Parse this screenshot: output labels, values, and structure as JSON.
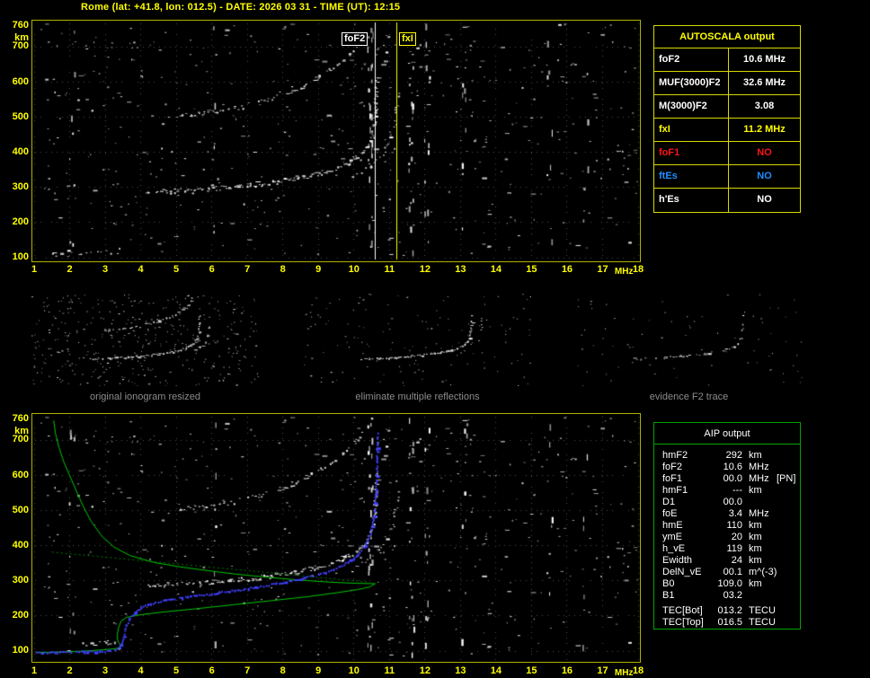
{
  "header": {
    "title": "Rome (lat: +41.8, lon: 012.5) - DATE: 2026 03 31 - TIME (UT): 12:15"
  },
  "colors": {
    "accent_yellow": "#ffff00",
    "frame_olive": "#b0b000",
    "profile_green": "#00c800",
    "trace_blue": "#4040ff",
    "no_red": "#ff1414",
    "ftes_blue": "#1e8fff",
    "caption_gray": "#8c8c8c",
    "table_green_border": "#00a400"
  },
  "autoscala_table": {
    "title": "AUTOSCALA output",
    "rows": [
      {
        "label": "foF2",
        "value": "10.6 MHz",
        "color": "white"
      },
      {
        "label": "MUF(3000)F2",
        "value": "32.6 MHz",
        "color": "white"
      },
      {
        "label": "M(3000)F2",
        "value": "3.08",
        "color": "white"
      },
      {
        "label": "fxI",
        "value": "11.2 MHz",
        "color": "yellow"
      },
      {
        "label": "foF1",
        "value": "NO",
        "color": "red"
      },
      {
        "label": "ftEs",
        "value": "NO",
        "color": "blue"
      },
      {
        "label": "h'Es",
        "value": "NO",
        "color": "white"
      }
    ]
  },
  "aip_table": {
    "title": "AIP output",
    "rows": [
      {
        "label": "hmF2",
        "value": "292",
        "unit": "km",
        "extra": ""
      },
      {
        "label": "foF2",
        "value": "10.6",
        "unit": "MHz",
        "extra": ""
      },
      {
        "label": "foF1",
        "value": "00.0",
        "unit": "MHz",
        "extra": "[PN]"
      },
      {
        "label": "hmF1",
        "value": "---",
        "unit": "km",
        "extra": ""
      },
      {
        "label": "D1",
        "value": "00.0",
        "unit": "",
        "extra": ""
      },
      {
        "label": "foE",
        "value": "3.4",
        "unit": "MHz",
        "extra": ""
      },
      {
        "label": "hmE",
        "value": "110",
        "unit": "km",
        "extra": ""
      },
      {
        "label": "ymE",
        "value": "20",
        "unit": "km",
        "extra": ""
      },
      {
        "label": "h_vE",
        "value": "119",
        "unit": "km",
        "extra": ""
      },
      {
        "label": "Ewidth",
        "value": "24",
        "unit": "km",
        "extra": ""
      },
      {
        "label": "DelN_vE",
        "value": "00.1",
        "unit": "m^(-3)",
        "extra": ""
      },
      {
        "label": "B0",
        "value": "109.0",
        "unit": "km",
        "extra": ""
      },
      {
        "label": "B1",
        "value": "03.2",
        "unit": "",
        "extra": ""
      },
      {
        "label": "TEC[Bot]",
        "value": "013.2",
        "unit": "TECU",
        "extra": ""
      },
      {
        "label": "TEC[Top]",
        "value": "016.5",
        "unit": "TECU",
        "extra": ""
      }
    ]
  },
  "thumbnails": [
    {
      "caption": "original ionogram resized"
    },
    {
      "caption": "eliminate multiple reflections"
    },
    {
      "caption": "evidence F2 trace"
    }
  ],
  "chart_data": [
    {
      "type": "scatter",
      "title": "recorded ionogram with autoscaled critical frequencies",
      "xlabel": "MHz",
      "ylabel": "km",
      "xlim": [
        1,
        18
      ],
      "ylim": [
        100,
        760
      ],
      "x_ticks": [
        1,
        2,
        3,
        4,
        5,
        6,
        7,
        8,
        9,
        10,
        11,
        12,
        13,
        14,
        15,
        16,
        17,
        18
      ],
      "y_ticks": [
        760,
        700,
        600,
        500,
        400,
        300,
        200,
        100
      ],
      "grid": "dotted",
      "annotations": [
        {
          "label": "foF2",
          "x_mhz": 10.6,
          "color": "#ffffff"
        },
        {
          "label": "fxI",
          "x_mhz": 11.2,
          "color": "#ffff00"
        }
      ],
      "series": [
        {
          "name": "F2-trace-1st-hop",
          "style": "speckle",
          "density": 0.85,
          "min_gray": 180,
          "points": [
            [
              4.15,
              288
            ],
            [
              4.7,
              290
            ],
            [
              5.3,
              293
            ],
            [
              5.9,
              297
            ],
            [
              6.5,
              302
            ],
            [
              7.1,
              308
            ],
            [
              7.7,
              316
            ],
            [
              8.3,
              326
            ],
            [
              8.9,
              338
            ],
            [
              9.4,
              352
            ],
            [
              9.8,
              368
            ],
            [
              10.1,
              388
            ],
            [
              10.35,
              415
            ],
            [
              10.5,
              450
            ],
            [
              10.57,
              495
            ],
            [
              10.61,
              555
            ],
            [
              10.63,
              615
            ]
          ]
        },
        {
          "name": "F2-trace-2nd-hop",
          "style": "speckle",
          "density": 0.55,
          "min_gray": 165,
          "points": [
            [
              5.0,
              505
            ],
            [
              5.6,
              510
            ],
            [
              6.2,
              518
            ],
            [
              6.8,
              530
            ],
            [
              7.4,
              545
            ],
            [
              8.0,
              565
            ],
            [
              8.5,
              588
            ],
            [
              9.0,
              614
            ],
            [
              9.4,
              642
            ],
            [
              9.75,
              672
            ],
            [
              10.05,
              700
            ],
            [
              10.25,
              728
            ]
          ]
        },
        {
          "name": "X-mode-trace",
          "style": "speckle",
          "density": 0.45,
          "min_gray": 160,
          "points": [
            [
              9.9,
              330
            ],
            [
              10.3,
              352
            ],
            [
              10.7,
              382
            ],
            [
              10.95,
              420
            ],
            [
              11.1,
              465
            ],
            [
              11.18,
              525
            ],
            [
              11.22,
              600
            ]
          ]
        },
        {
          "name": "E-region-echoes",
          "style": "speckle",
          "density": 0.3,
          "min_gray": 140,
          "points": [
            [
              1.3,
              108
            ],
            [
              2.1,
              112
            ],
            [
              2.9,
              116
            ],
            [
              3.4,
              119
            ]
          ]
        }
      ]
    },
    {
      "type": "scatter",
      "title": "ionogram with restored trace and electron density profile",
      "xlabel": "MHz",
      "ylabel": "km",
      "xlim": [
        1,
        18
      ],
      "ylim": [
        100,
        760
      ],
      "x_ticks": [
        1,
        2,
        3,
        4,
        5,
        6,
        7,
        8,
        9,
        10,
        11,
        12,
        13,
        14,
        15,
        16,
        17,
        18
      ],
      "y_ticks": [
        760,
        700,
        600,
        500,
        400,
        300,
        200,
        100
      ],
      "grid": "dotted",
      "annotations": [],
      "series": [
        {
          "name": "F2-trace-1st-hop",
          "style": "speckle",
          "density": 0.85,
          "min_gray": 180,
          "points": [
            [
              4.15,
              288
            ],
            [
              4.7,
              290
            ],
            [
              5.3,
              293
            ],
            [
              5.9,
              297
            ],
            [
              6.5,
              302
            ],
            [
              7.1,
              308
            ],
            [
              7.7,
              316
            ],
            [
              8.3,
              326
            ],
            [
              8.9,
              338
            ],
            [
              9.4,
              352
            ],
            [
              9.8,
              368
            ],
            [
              10.1,
              388
            ],
            [
              10.35,
              415
            ],
            [
              10.5,
              450
            ],
            [
              10.57,
              495
            ],
            [
              10.61,
              555
            ],
            [
              10.63,
              615
            ]
          ]
        },
        {
          "name": "F2-trace-2nd-hop",
          "style": "speckle",
          "density": 0.55,
          "min_gray": 165,
          "points": [
            [
              5.0,
              505
            ],
            [
              5.6,
              510
            ],
            [
              6.2,
              518
            ],
            [
              6.8,
              530
            ],
            [
              7.4,
              545
            ],
            [
              8.0,
              565
            ],
            [
              8.5,
              588
            ],
            [
              9.0,
              614
            ],
            [
              9.4,
              642
            ],
            [
              9.75,
              672
            ],
            [
              10.05,
              700
            ],
            [
              10.25,
              728
            ]
          ]
        },
        {
          "name": "X-mode-trace",
          "style": "speckle",
          "density": 0.45,
          "min_gray": 160,
          "points": [
            [
              9.9,
              330
            ],
            [
              10.3,
              352
            ],
            [
              10.7,
              382
            ],
            [
              10.95,
              420
            ],
            [
              11.1,
              465
            ],
            [
              11.18,
              525
            ],
            [
              11.22,
              600
            ]
          ]
        },
        {
          "name": "E-region-bright-echo",
          "style": "speckle",
          "density": 0.7,
          "min_gray": 210,
          "points": [
            [
              2.4,
              120
            ],
            [
              3.3,
              126
            ]
          ]
        },
        {
          "name": "profile-connecting-line",
          "style": "dashline",
          "color": "#007a00",
          "points": [
            [
              1.5,
              382
            ],
            [
              10.45,
              296
            ]
          ]
        },
        {
          "name": "electron-density-profile",
          "style": "line",
          "color": "#00c800",
          "points": [
            [
              1.55,
              757
            ],
            [
              1.6,
              720
            ],
            [
              1.7,
              680
            ],
            [
              1.83,
              640
            ],
            [
              2.0,
              600
            ],
            [
              2.17,
              560
            ],
            [
              2.37,
              515
            ],
            [
              2.6,
              470
            ],
            [
              2.9,
              428
            ],
            [
              3.25,
              396
            ],
            [
              3.7,
              372
            ],
            [
              4.4,
              352
            ],
            [
              5.1,
              340
            ],
            [
              5.9,
              329
            ],
            [
              6.7,
              319
            ],
            [
              7.6,
              310
            ],
            [
              8.5,
              302
            ],
            [
              9.4,
              296
            ],
            [
              10.1,
              293
            ],
            [
              10.6,
              292
            ],
            [
              10.45,
              283
            ],
            [
              10.1,
              275
            ],
            [
              9.5,
              266
            ],
            [
              8.7,
              255
            ],
            [
              7.7,
              244
            ],
            [
              6.6,
              232
            ],
            [
              5.5,
              220
            ],
            [
              4.6,
              211
            ],
            [
              3.95,
              203
            ],
            [
              3.6,
              196
            ],
            [
              3.45,
              186
            ],
            [
              3.38,
              168
            ],
            [
              3.34,
              148
            ],
            [
              3.35,
              130
            ],
            [
              3.4,
              121
            ],
            [
              3.45,
              114
            ],
            [
              3.35,
              108
            ],
            [
              3.0,
              104
            ],
            [
              2.4,
              100
            ],
            [
              1.6,
              97
            ],
            [
              1.05,
              96
            ]
          ]
        },
        {
          "name": "autoscaled-restored-trace",
          "style": "dots",
          "color": "#4040ff",
          "points": [
            [
              1.05,
              97
            ],
            [
              1.7,
              98
            ],
            [
              2.4,
              100
            ],
            [
              2.9,
              101
            ],
            [
              3.25,
              104
            ],
            [
              3.4,
              112
            ],
            [
              3.47,
              130
            ],
            [
              3.52,
              152
            ],
            [
              3.58,
              175
            ],
            [
              3.68,
              196
            ],
            [
              3.82,
              213
            ],
            [
              4.0,
              226
            ],
            [
              4.25,
              237
            ],
            [
              4.7,
              247
            ],
            [
              5.4,
              257
            ],
            [
              6.2,
              268
            ],
            [
              7.0,
              280
            ],
            [
              7.8,
              294
            ],
            [
              8.6,
              310
            ],
            [
              9.2,
              327
            ],
            [
              9.7,
              348
            ],
            [
              10.05,
              372
            ],
            [
              10.3,
              402
            ],
            [
              10.45,
              438
            ],
            [
              10.54,
              485
            ],
            [
              10.6,
              550
            ],
            [
              10.63,
              630
            ],
            [
              10.65,
              720
            ]
          ]
        }
      ]
    }
  ]
}
